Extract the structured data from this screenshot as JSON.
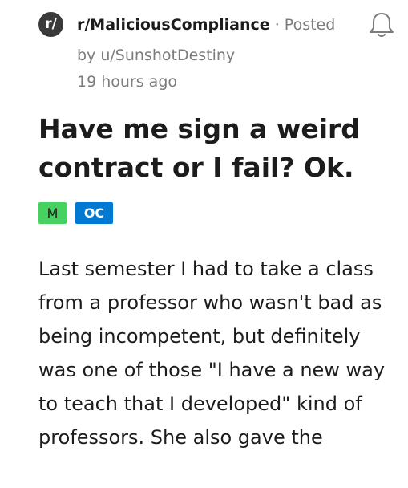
{
  "header": {
    "subreddit_avatar_text": "r/",
    "subreddit": "r/MaliciousCompliance",
    "separator": "·",
    "posted_label": "Posted",
    "author": "by u/SunshotDestiny",
    "time": "19 hours ago",
    "bell_icon": "bell-icon"
  },
  "post": {
    "title": "Have me sign a weird contract or I fail? Ok.",
    "flairs": [
      "M",
      "OC"
    ],
    "body": "Last semester I had to take a class from a professor who wasn't bad as being incompetent, but definitely was one of those \"I have a new way to teach that I developed\" kind of professors. She also gave the"
  },
  "colors": {
    "flair_m": "#46d160",
    "flair_oc": "#0079d3",
    "meta_gray": "#7c7c7c"
  }
}
